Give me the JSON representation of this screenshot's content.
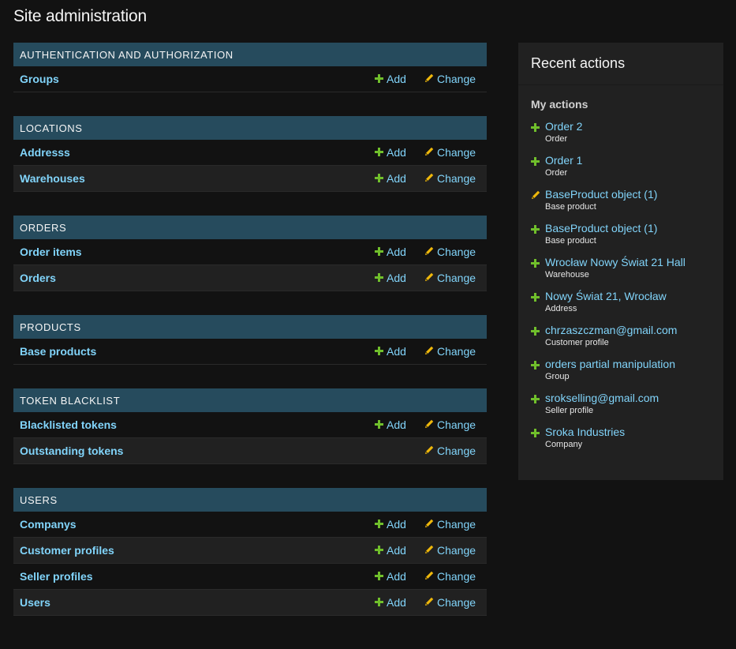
{
  "page_title": "Site administration",
  "labels": {
    "add": "Add",
    "change": "Change"
  },
  "colors": {
    "caption_bg": "#264b5d",
    "link": "#81d4fa",
    "add_icon": "#70bf2b",
    "change_icon": "#efb80b",
    "sidebar_bg": "#212121",
    "page_bg": "#121212"
  },
  "apps": [
    {
      "caption": "AUTHENTICATION AND AUTHORIZATION",
      "models": [
        {
          "name": "Groups",
          "add": true
        }
      ]
    },
    {
      "caption": "LOCATIONS",
      "models": [
        {
          "name": "Addresss",
          "add": true
        },
        {
          "name": "Warehouses",
          "add": true
        }
      ]
    },
    {
      "caption": "ORDERS",
      "models": [
        {
          "name": "Order items",
          "add": true
        },
        {
          "name": "Orders",
          "add": true
        }
      ]
    },
    {
      "caption": "PRODUCTS",
      "models": [
        {
          "name": "Base products",
          "add": true
        }
      ]
    },
    {
      "caption": "TOKEN BLACKLIST",
      "models": [
        {
          "name": "Blacklisted tokens",
          "add": true
        },
        {
          "name": "Outstanding tokens",
          "add": false
        }
      ]
    },
    {
      "caption": "USERS",
      "models": [
        {
          "name": "Companys",
          "add": true
        },
        {
          "name": "Customer profiles",
          "add": true
        },
        {
          "name": "Seller profiles",
          "add": true
        },
        {
          "name": "Users",
          "add": true
        }
      ]
    }
  ],
  "recent_actions": {
    "title": "Recent actions",
    "subtitle": "My actions",
    "items": [
      {
        "icon": "plus-icon",
        "label": "Order 2",
        "type": "Order"
      },
      {
        "icon": "plus-icon",
        "label": "Order 1",
        "type": "Order"
      },
      {
        "icon": "pencil-icon",
        "label": "BaseProduct object (1)",
        "type": "Base product"
      },
      {
        "icon": "plus-icon",
        "label": "BaseProduct object (1)",
        "type": "Base product"
      },
      {
        "icon": "plus-icon",
        "label": "Wrocław Nowy Świat 21 Hall",
        "type": "Warehouse"
      },
      {
        "icon": "plus-icon",
        "label": "Nowy Świat 21, Wrocław",
        "type": "Address"
      },
      {
        "icon": "plus-icon",
        "label": "chrzaszczman@gmail.com",
        "type": "Customer profile"
      },
      {
        "icon": "plus-icon",
        "label": "orders partial manipulation",
        "type": "Group"
      },
      {
        "icon": "plus-icon",
        "label": "srokselling@gmail.com",
        "type": "Seller profile"
      },
      {
        "icon": "plus-icon",
        "label": "Sroka Industries",
        "type": "Company"
      }
    ]
  }
}
